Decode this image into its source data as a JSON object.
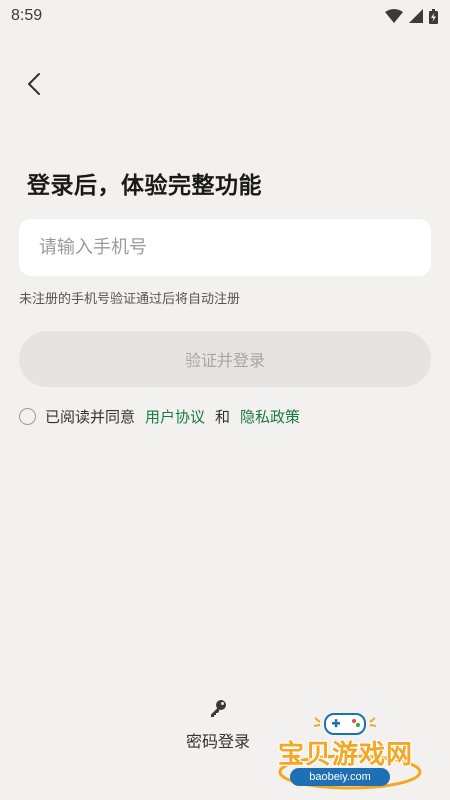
{
  "status_bar": {
    "time": "8:59",
    "icons": [
      "wifi-icon",
      "signal-icon",
      "battery-icon"
    ]
  },
  "nav": {
    "back_icon": "chevron-left-icon"
  },
  "title": "登录后，体验完整功能",
  "phone_input": {
    "placeholder": "请输入手机号",
    "value": ""
  },
  "hint": "未注册的手机号验证通过后将自动注册",
  "login_button": {
    "label": "验证并登录"
  },
  "agreement": {
    "prefix": "已阅读并同意",
    "user_agreement": "用户协议",
    "conjunction": "和",
    "privacy_policy": "隐私政策"
  },
  "password_login": {
    "label": "密码登录",
    "icon": "key-icon"
  },
  "watermark": {
    "brand": "宝贝游戏网",
    "url": "baobeiy.com"
  },
  "colors": {
    "background": "#f2f1ef",
    "link": "#1a7a44",
    "button_disabled": "#e6e4e0"
  }
}
